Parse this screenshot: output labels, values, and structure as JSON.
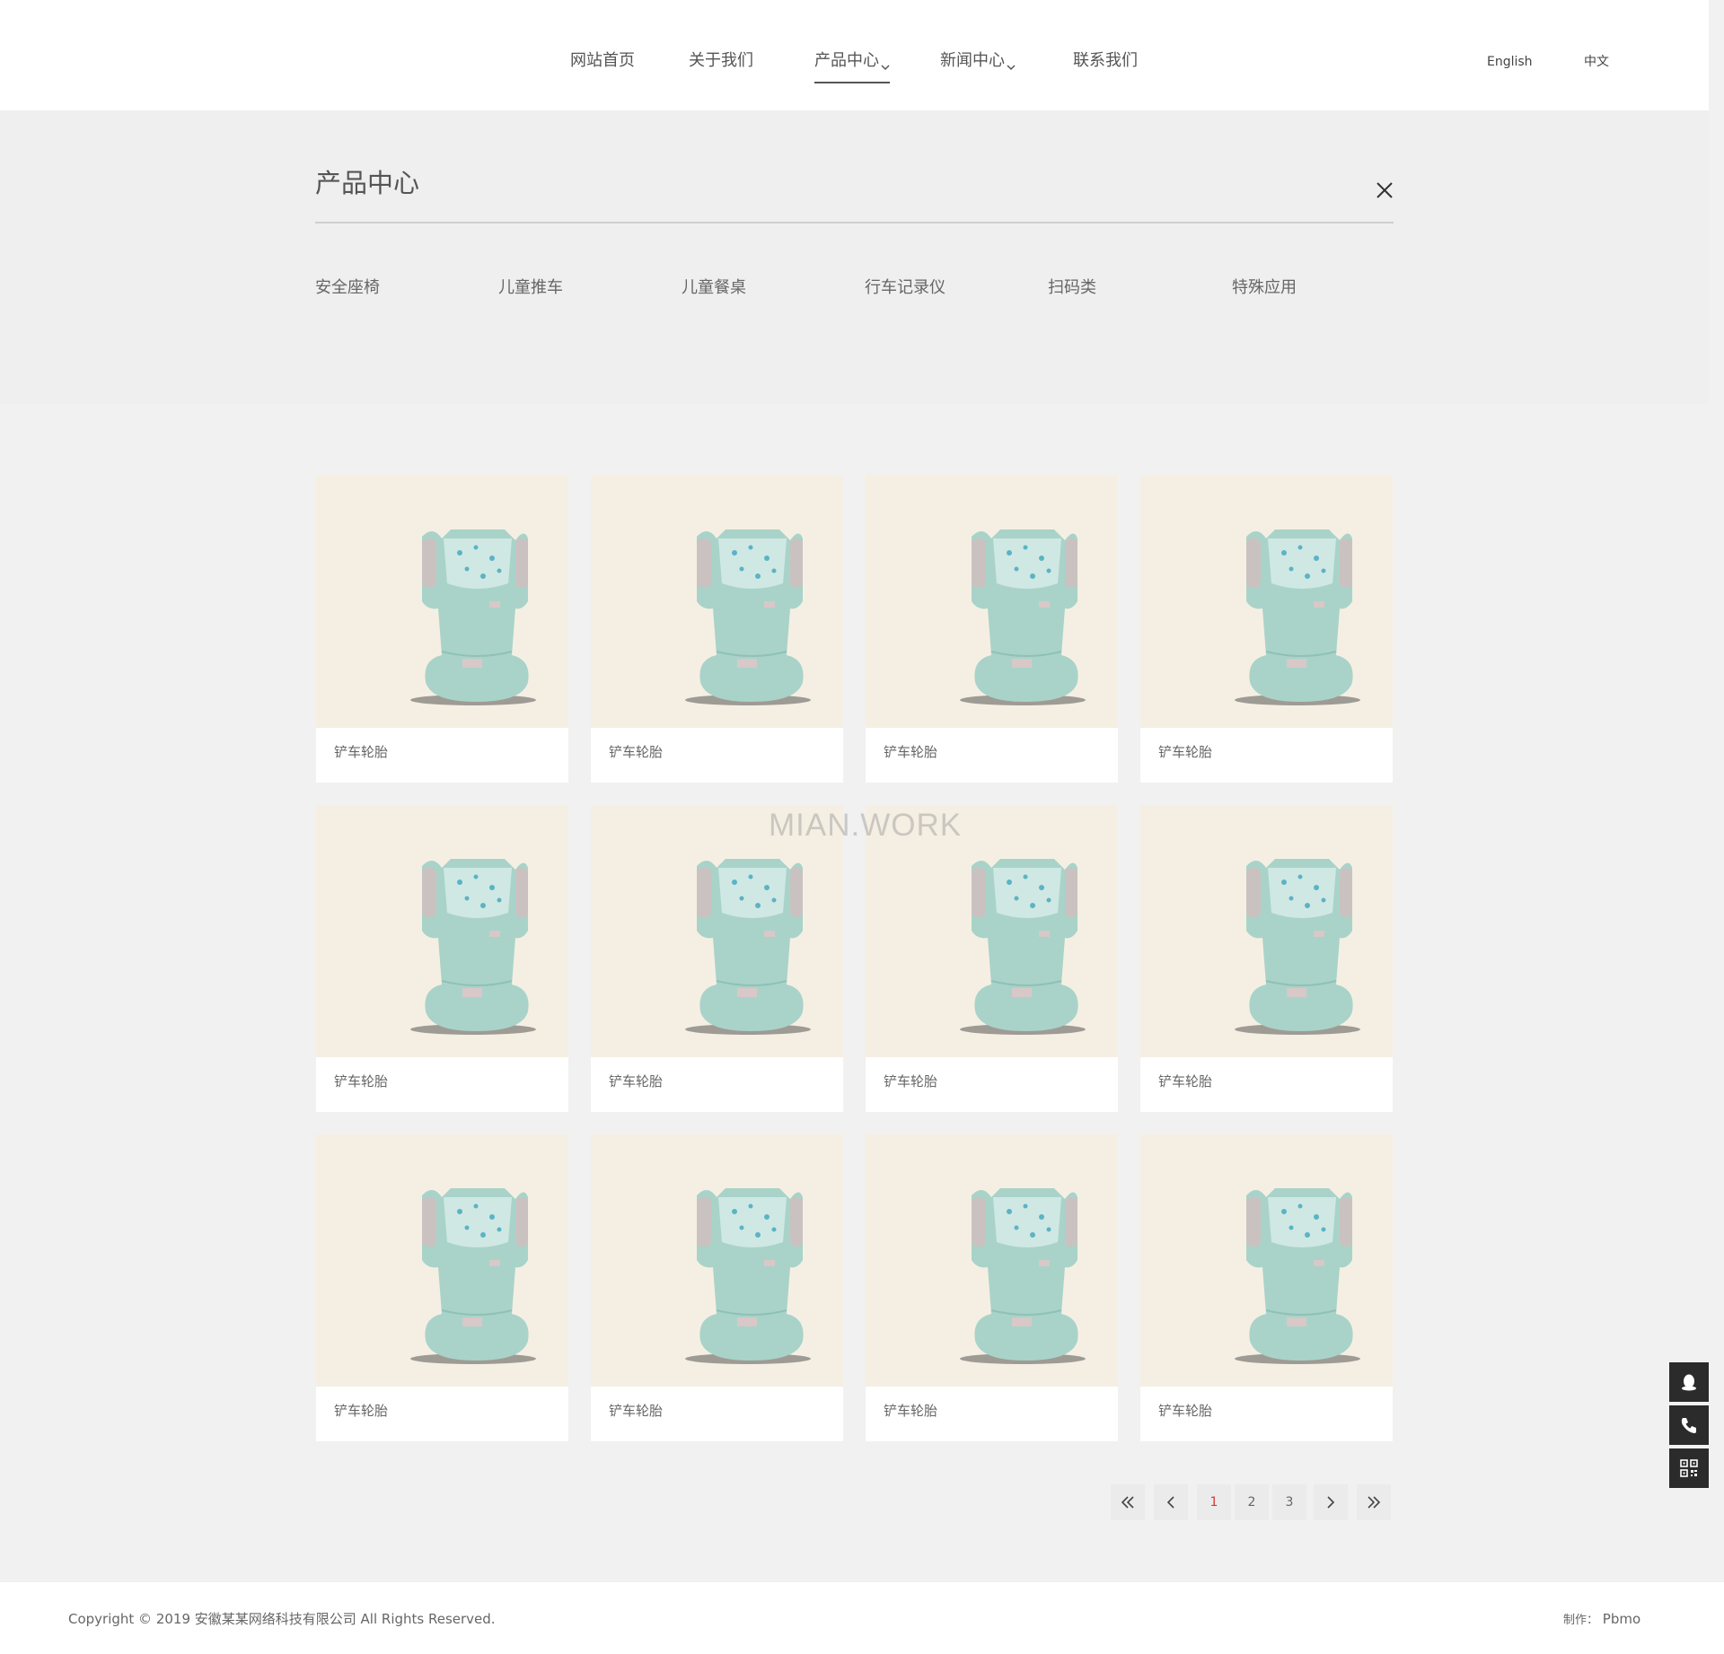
{
  "header": {
    "nav": [
      {
        "label": "网站首页"
      },
      {
        "label": "关于我们"
      },
      {
        "label": "产品中心"
      },
      {
        "label": "新闻中心"
      },
      {
        "label": "联系我们"
      }
    ],
    "lang_en": "English",
    "lang_zh": "中文"
  },
  "panel": {
    "title": "产品中心",
    "categories": [
      "安全座椅",
      "儿童推车",
      "儿童餐桌",
      "行车记录仪",
      "扫码类",
      "特殊应用"
    ]
  },
  "products": [
    {
      "name": "铲车轮胎"
    },
    {
      "name": "铲车轮胎"
    },
    {
      "name": "铲车轮胎"
    },
    {
      "name": "铲车轮胎"
    },
    {
      "name": "铲车轮胎"
    },
    {
      "name": "铲车轮胎"
    },
    {
      "name": "铲车轮胎"
    },
    {
      "name": "铲车轮胎"
    },
    {
      "name": "铲车轮胎"
    },
    {
      "name": "铲车轮胎"
    },
    {
      "name": "铲车轮胎"
    },
    {
      "name": "铲车轮胎"
    }
  ],
  "watermark": "MIAN.WORK",
  "pagination": {
    "pages": [
      "1",
      "2",
      "3"
    ],
    "current": "1"
  },
  "footer": {
    "copyright": "Copyright © 2019 安徽某某网络科技有限公司 All Rights Reserved.",
    "maker_label": "制作：",
    "maker_name": "Pbmo"
  },
  "colors": {
    "accent_current_page": "#dd3333",
    "product_bg": "#f5efe3",
    "side_tools_bg": "#2b2b2b"
  },
  "icons": {
    "nav_dropdown": "chevron-down-icon",
    "panel_close": "close-icon",
    "pager_first": "double-chevron-left-icon",
    "pager_prev": "chevron-left-icon",
    "pager_next": "chevron-right-icon",
    "pager_last": "double-chevron-right-icon",
    "side_qq": "qq-penguin-icon",
    "side_phone": "phone-icon",
    "side_qr": "qr-code-icon"
  }
}
